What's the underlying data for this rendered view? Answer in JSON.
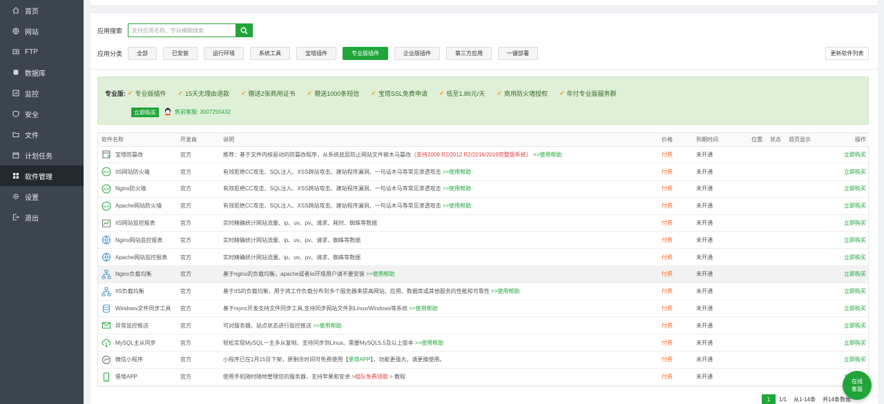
{
  "sidebar": {
    "items": [
      {
        "label": "首页",
        "icon": "home-icon"
      },
      {
        "label": "网站",
        "icon": "globe-icon"
      },
      {
        "label": "FTP",
        "icon": "ftp-icon"
      },
      {
        "label": "数据库",
        "icon": "database-icon"
      },
      {
        "label": "监控",
        "icon": "monitor-icon"
      },
      {
        "label": "安全",
        "icon": "shield-icon"
      },
      {
        "label": "文件",
        "icon": "folder-icon"
      },
      {
        "label": "计划任务",
        "icon": "calendar-icon"
      },
      {
        "label": "软件管理",
        "icon": "grid-icon",
        "active": true
      },
      {
        "label": "设置",
        "icon": "gear-icon"
      },
      {
        "label": "退出",
        "icon": "logout-icon"
      }
    ]
  },
  "search": {
    "label": "应用搜索",
    "placeholder": "支持应用名称、字段模糊搜索"
  },
  "categories": {
    "label": "应用分类",
    "items": [
      "全部",
      "已安装",
      "运行环境",
      "系统工具",
      "宝塔插件",
      "专业版插件",
      "企业版插件",
      "第三方应用",
      "一键部署"
    ],
    "active_index": 5,
    "update_label": "更新软件列表"
  },
  "promo": {
    "title": "专业版:",
    "features": [
      "专业版插件",
      "15天无理由退款",
      "赠送2张商用证书",
      "赠送1000条短信",
      "宝塔SSL免费申请",
      "低至1.86元/天",
      "商用防火墙授权",
      "年付专业版服务群"
    ],
    "buy_label": "立即购买",
    "qq_label": "售前客服: 3007255432"
  },
  "table": {
    "headers": {
      "name": "软件名称",
      "dev": "开发商",
      "desc": "说明",
      "price": "价格",
      "expire": "到期时间",
      "position": "位置",
      "status": "状态",
      "home": "首页显示",
      "action": "操作"
    },
    "rows": [
      {
        "name": "宝塔防篡改",
        "icon": "tamper-icon",
        "dev": "官方",
        "desc": "推荐：基于文件内核驱动的防篡改程序，从系统底层防止网站文件被木马篡改",
        "desc_red": "（支持2008 R2/2012 R2/2016/2019完整版系统）",
        "desc_link": ">>使用帮助",
        "price": "付费",
        "expire": "未开通",
        "action": "立即购买"
      },
      {
        "name": "IIS网站防火墙",
        "icon": "firewall-icon",
        "dev": "官方",
        "desc": "有效拒绝CC攻击、SQL注入、XSS跨站攻击、建站程序漏洞、一句话木马等常见渗透攻击",
        "desc_red": "",
        "desc_link": ">>使用帮助",
        "price": "付费",
        "expire": "未开通",
        "action": "立即购买"
      },
      {
        "name": "Nginx防火墙",
        "icon": "firewall-icon",
        "dev": "官方",
        "desc": "有效拒绝CC攻击、SQL注入、XSS跨站攻击、建站程序漏洞、一句话木马等常见渗透攻击",
        "desc_red": "",
        "desc_link": ">>使用帮助",
        "price": "付费",
        "expire": "未开通",
        "action": "立即购买"
      },
      {
        "name": "Apache网站防火墙",
        "icon": "firewall-icon",
        "dev": "官方",
        "desc": "有效拒绝CC攻击、SQL注入、XSS跨站攻击、建站程序漏洞、一句话木马等常见渗透攻击",
        "desc_red": "",
        "desc_link": ">>使用帮助",
        "price": "付费",
        "expire": "未开通",
        "action": "立即购买"
      },
      {
        "name": "IIS网站监控报表",
        "icon": "chart-icon",
        "dev": "官方",
        "desc": "实时精确统计网站流量、ip、uv、pv、请求、耗时、蜘蛛等数据",
        "desc_red": "",
        "desc_link": "",
        "price": "付费",
        "expire": "未开通",
        "action": "立即购买"
      },
      {
        "name": "Nginx网站监控报表",
        "icon": "globe-report-icon",
        "dev": "官方",
        "desc": "实时精确统计网站流量、ip、uv、pv、请求、蜘蛛等数据",
        "desc_red": "",
        "desc_link": "",
        "price": "付费",
        "expire": "未开通",
        "action": "立即购买"
      },
      {
        "name": "Apache网站监控报表",
        "icon": "globe-report-icon",
        "dev": "官方",
        "desc": "实时精确统计网站流量、ip、uv、pv、请求、蜘蛛等数据",
        "desc_red": "",
        "desc_link": "",
        "price": "付费",
        "expire": "未开通",
        "action": "立即购买"
      },
      {
        "name": "Nginx负载均衡",
        "icon": "network-icon",
        "dev": "官方",
        "desc": "基于nginx的负载均衡，apache或者iis环境用户请不要安装",
        "desc_red": "",
        "desc_link": ">>使用帮助",
        "price": "付费",
        "expire": "未开通",
        "action": "立即购买",
        "highlight": true
      },
      {
        "name": "IIS负载均衡",
        "icon": "network-icon",
        "dev": "官方",
        "desc": "基于IIS的负载均衡，用于将工作负载分布到多个服务器来提高网站、应用、数据库或其他服务的性能和可靠性",
        "desc_red": "",
        "desc_link": ">>使用帮助",
        "price": "付费",
        "expire": "未开通",
        "action": "立即购买"
      },
      {
        "name": "Windows文件同步工具",
        "icon": "sync-icon",
        "dev": "官方",
        "desc": "基于rsync开发支持文件同步工具,支持同步网站文件到Linux/Windows等系统",
        "desc_red": "",
        "desc_link": ">>使用帮助",
        "price": "付费",
        "expire": "未开通",
        "action": "立即购买"
      },
      {
        "name": "异常监控推送",
        "icon": "mail-icon",
        "dev": "官方",
        "desc": "可对服务器、站点状态进行监控推送",
        "desc_red": "",
        "desc_link": ">>使用帮助",
        "price": "付费",
        "expire": "未开通",
        "action": "立即购买"
      },
      {
        "name": "MySQL主从同步",
        "icon": "cloud-sync-icon",
        "dev": "官方",
        "desc": "轻松实现MySQL一主多从复制，支持同步到Linux、需要MySQL5.5及以上版本",
        "desc_red": "",
        "desc_link": ">>使用帮助",
        "price": "付费",
        "expire": "未开通",
        "action": "立即购买"
      },
      {
        "name": "微信小程序",
        "icon": "miniapp-icon",
        "dev": "官方",
        "desc": "小程序已在1月15日下架，原剩余时间可免费使用【",
        "desc_mid": "堡塔APP",
        "desc_tail": "】，功能更强大，请更换使用。",
        "desc_red": "",
        "desc_link": "",
        "price": "付费",
        "expire": "未开通",
        "action": "立即购买"
      },
      {
        "name": "堡塔APP",
        "icon": "app-icon",
        "dev": "官方",
        "desc": "使用手机随时随地管理您的服务器，支持苹果和安卓 >",
        "desc_red": "组队免费领取",
        "desc_tail": " > 教程",
        "desc_link": "",
        "price": "付费",
        "expire": "未开通",
        "action": "立即购买"
      }
    ]
  },
  "pager": {
    "current": "1",
    "pages": "1/1",
    "range": "从1-14条",
    "total": "共14条数据"
  },
  "float_help": {
    "line1": "在线",
    "line2": "客服"
  },
  "colors": {
    "accent": "#20a53a",
    "price": "#fc6d26",
    "sidebar": "#3c444d",
    "sidebar_active": "#22292f"
  }
}
